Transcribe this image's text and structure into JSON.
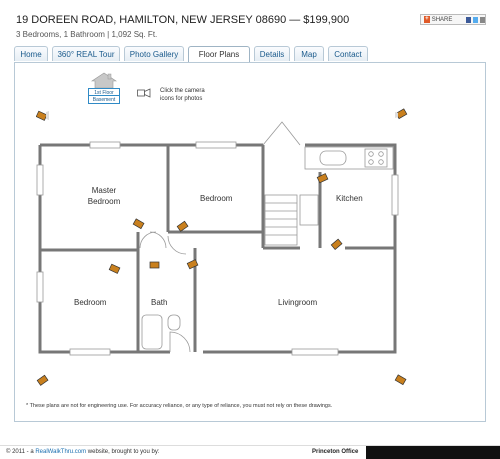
{
  "header": {
    "title": "19 DOREEN ROAD, HAMILTON, NEW JERSEY 08690  —  $199,900",
    "subtitle": "3 Bedrooms, 1 Bathroom  |   1,092 Sq. Ft.",
    "share_label": "SHARE"
  },
  "tabs": [
    {
      "label": "Home",
      "active": false
    },
    {
      "label": "360° REAL Tour",
      "active": false
    },
    {
      "label": "Photo Gallery",
      "active": false
    },
    {
      "label": "Floor Plans",
      "active": true
    },
    {
      "label": "Details",
      "active": false
    },
    {
      "label": "Map",
      "active": false
    },
    {
      "label": "Contact",
      "active": false
    }
  ],
  "floor_selector": {
    "items": [
      "1st Floor",
      "Basement"
    ]
  },
  "hint": "Click the camera icons for photos",
  "rooms": {
    "master": "Master Bedroom",
    "bedroom1": "Bedroom",
    "kitchen": "Kitchen",
    "bedroom2": "Bedroom",
    "bath": "Bath",
    "living": "Livingroom"
  },
  "disclaimer": "* These plans are not for engineering use. For accuracy reliance, or any type of reliance, you must not rely on these drawings.",
  "footer": {
    "prefix": "© 2011 - a ",
    "link": "RealWalkThru.com",
    "suffix": " website, brought to you by:",
    "office": "Princeton Office"
  },
  "colors": {
    "wall": "#777777",
    "tab_link": "#1a5a8c",
    "accent": "#2f8ac6",
    "camera": "#c9801e"
  }
}
